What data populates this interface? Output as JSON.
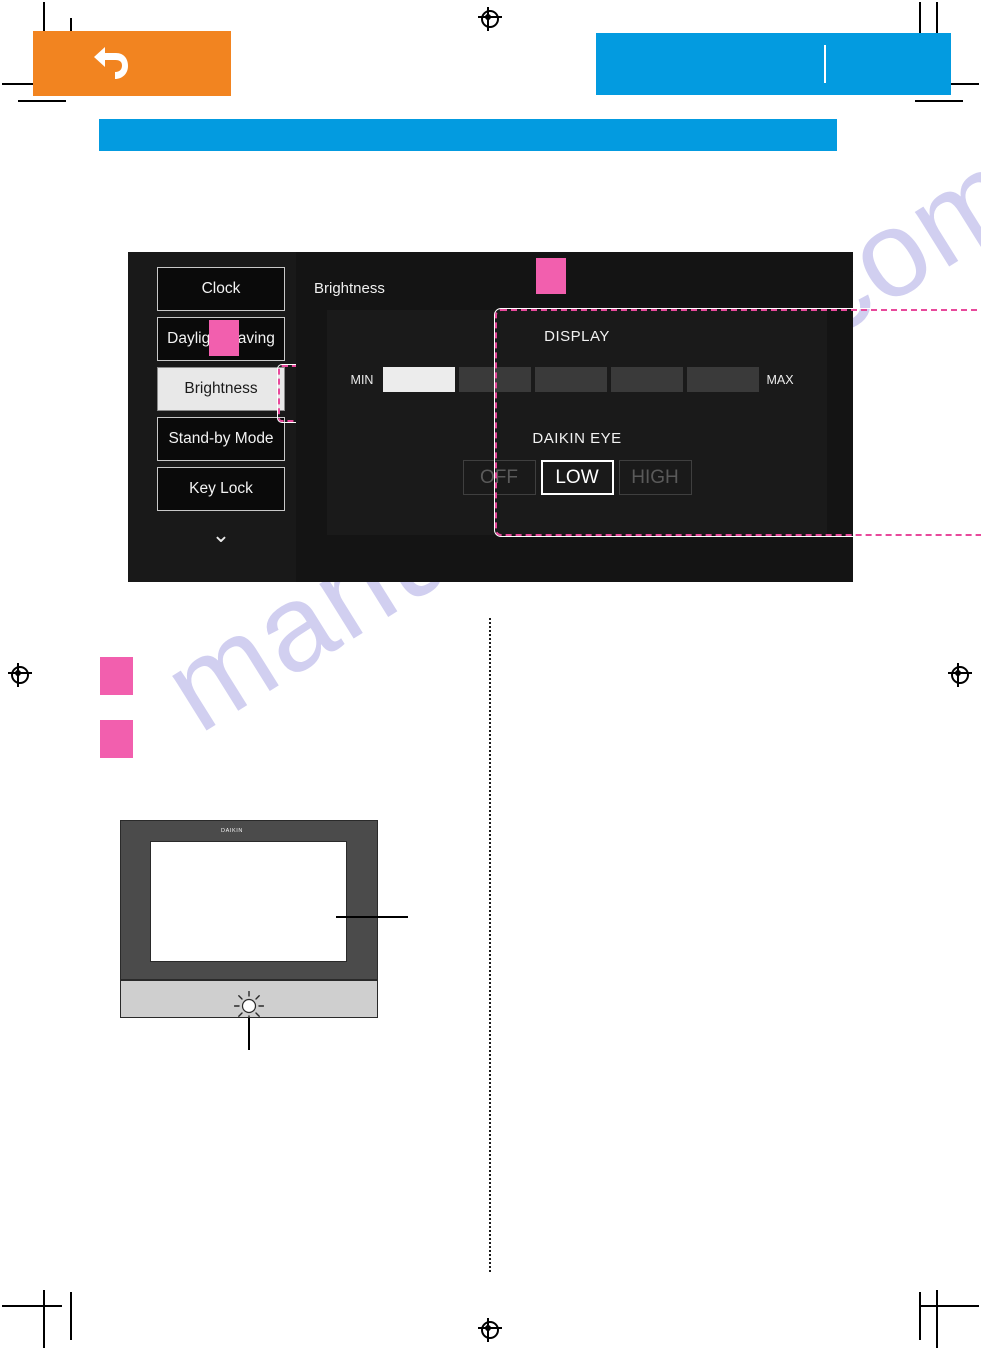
{
  "page": {
    "watermark": "manualshive.com",
    "background_color": "#ffffff"
  },
  "colors": {
    "orange_banner": "#F28420",
    "blue_banner": "#039BE0",
    "annotation_pink": "#E8489B",
    "marker_pink": "#F25FAE",
    "ui_background": "#0d0d0d",
    "selected_item_bg": "#e8e8e8"
  },
  "header": {
    "back_icon": "back-arrow-icon",
    "orange_banner_label": "",
    "blue_banner_label": "",
    "blue_subbanner_label": ""
  },
  "device_ui": {
    "title": "Brightness",
    "menu": {
      "items": [
        {
          "label": "Clock",
          "selected": false
        },
        {
          "label": "Daylight Saving",
          "selected": false
        },
        {
          "label": "Brightness",
          "selected": true
        },
        {
          "label": "Stand-by Mode",
          "selected": false
        },
        {
          "label": "Key Lock",
          "selected": false
        }
      ],
      "scroll_down_icon": "chevron-down-icon"
    },
    "display_section": {
      "label": "DISPLAY",
      "min_label": "MIN",
      "max_label": "MAX",
      "segments": [
        {
          "filled": true
        },
        {
          "filled": false
        },
        {
          "filled": false
        },
        {
          "filled": false
        },
        {
          "filled": false
        }
      ],
      "level": 1,
      "level_max": 5
    },
    "daikin_eye_section": {
      "label": "DAIKIN EYE",
      "options": [
        {
          "label": "OFF",
          "active": false,
          "enabled": false
        },
        {
          "label": "LOW",
          "active": true,
          "enabled": true
        },
        {
          "label": "HIGH",
          "active": false,
          "enabled": false
        }
      ],
      "selected": "LOW"
    }
  },
  "callouts": {
    "marker_on_menu": "",
    "marker_on_panel": "",
    "marker_body_1": "",
    "marker_body_2": ""
  },
  "illustration": {
    "brand_logo": "DAIKIN",
    "screen_caption": "",
    "eye_lamp_caption": "",
    "eye_lamp_icon": "sun-lamp-icon"
  }
}
